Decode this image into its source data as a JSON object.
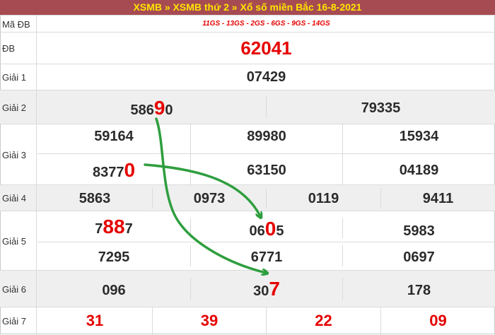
{
  "header": {
    "xsmb": "XSMB",
    "sep1": " » ",
    "xsmb_thu": "XSMB thứ 2",
    "sep2": " » ",
    "title": "Xổ số miền Bắc 16-8-2021"
  },
  "ma_db": {
    "label": "Mã ĐB",
    "value": "11GS - 13GS - 2GS - 6GS - 9GS - 14GS"
  },
  "db": {
    "label": "ĐB",
    "value": "62041"
  },
  "g1": {
    "label": "Giải 1",
    "value": "07429"
  },
  "g2": {
    "label": "Giải 2",
    "v1a": "586",
    "v1b": "9",
    "v1c": "0",
    "v2": "79335"
  },
  "g3": {
    "label": "Giải 3",
    "r1": [
      "59164",
      "89980",
      "15934"
    ],
    "r2a": "8377",
    "r2b": "0",
    "r2c": "63150",
    "r2d": "04189"
  },
  "g4": {
    "label": "Giải 4",
    "values": [
      "5863",
      "0973",
      "0119",
      "9411"
    ]
  },
  "g5": {
    "label": "Giải 5",
    "a1": "7",
    "a2": "88",
    "a3": "7",
    "b1": "06",
    "b2": "0",
    "b3": "5",
    "c": "5983",
    "r2": [
      "7295",
      "6771",
      "0697"
    ]
  },
  "g6": {
    "label": "Giải 6",
    "v1": "096",
    "v2a": "30",
    "v2b": "7",
    "v3": "178"
  },
  "g7": {
    "label": "Giải 7",
    "values": [
      "31",
      "39",
      "22",
      "09"
    ]
  },
  "colors": {
    "header_bg": "#a64b52",
    "header_text": "#ffe600",
    "accent_red": "#e60000",
    "arrow_green": "#2e9e3e"
  }
}
